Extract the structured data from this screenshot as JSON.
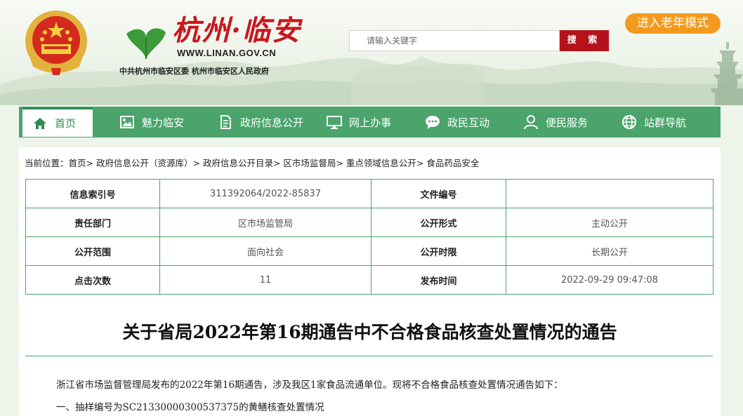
{
  "header": {
    "logo_title": "杭州·临安",
    "logo_url": "WWW.LINAN.GOV.CN",
    "logo_subtitle": "中共杭州市临安区委  杭州市临安区人民政府",
    "search_placeholder": "请输入关键字",
    "search_button": "搜 索",
    "elder_mode_button": "进入老年模式"
  },
  "nav": {
    "items": [
      {
        "label": "首页",
        "icon": "home-icon"
      },
      {
        "label": "魅力临安",
        "icon": "image-icon"
      },
      {
        "label": "政府信息公开",
        "icon": "document-icon"
      },
      {
        "label": "网上办事",
        "icon": "monitor-icon"
      },
      {
        "label": "政民互动",
        "icon": "chat-icon"
      },
      {
        "label": "便民服务",
        "icon": "user-icon"
      },
      {
        "label": "站群导航",
        "icon": "globe-icon"
      }
    ],
    "active": "首页"
  },
  "breadcrumb": {
    "prefix": "当前位置：",
    "items": [
      "首页",
      "政府信息公开（资源库）",
      "政府信息公开目录",
      "区市场监督局",
      "重点领域信息公开",
      "食品药品安全"
    ],
    "separator": "> "
  },
  "info_table": {
    "rows": [
      {
        "label1": "信息索引号",
        "value1": "311392064/2022-85837",
        "label2": "文件编号",
        "value2": ""
      },
      {
        "label1": "责任部门",
        "value1": "区市场监管局",
        "label2": "公开形式",
        "value2": "主动公开"
      },
      {
        "label1": "公开范围",
        "value1": "面向社会",
        "label2": "公开时限",
        "value2": "长期公开"
      },
      {
        "label1": "点击次数",
        "value1": "11",
        "label2": "发布时间",
        "value2": "2022-09-29 09:47:08"
      }
    ]
  },
  "article": {
    "title": "关于省局2022年第16期通告中不合格食品核查处置情况的通告",
    "paragraphs": [
      "浙江省市场监督管理局发布的2022年第16期通告，涉及我区1家食品流通单位。现将不合格食品核查处置情况通告如下：",
      "一、抽样编号为SC21330000300537375的黄鳝核查处置情况"
    ]
  },
  "colors": {
    "nav_green": "#4aa46b",
    "search_red": "#b5121b",
    "elder_orange": "#f39a1e",
    "logo_red": "#c8171e"
  }
}
